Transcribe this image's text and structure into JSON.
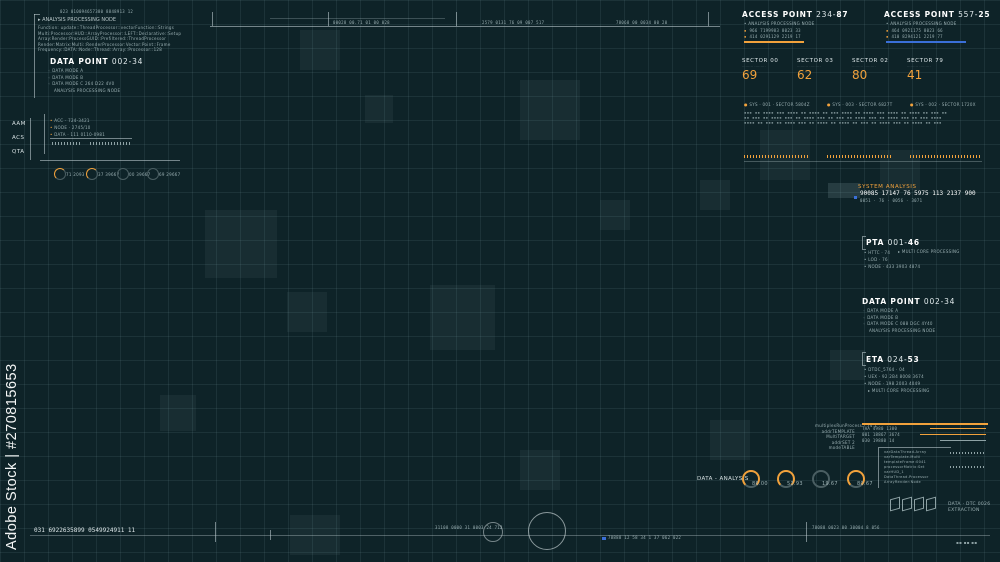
{
  "watermark": {
    "text": "Adobe Stock | #270815653"
  },
  "top_left_panel": {
    "code": "023  010094657380  8848913 12",
    "title": "ANALYSIS PROCESSING NODE",
    "lines": [
      "Function: update::ThreadProcessor::vectorFunction::Strings",
      "Multi:Processor:HUD::ArrayProcessor::LEFT::Declarative::Setup",
      "Array:Render:ProcessGUID::Prefiltered::ThreadProcessor",
      "Render:Matrix:Multi::RenderProcessor:Vector:Point::Frame",
      "Frequency::DATA::Node::Thread::Array::Processor::128"
    ]
  },
  "data_point_left": {
    "title": "DATA POINT",
    "value": "002-34",
    "items": [
      "DATA MODE A",
      "DATA MODE B",
      "DATA MODE C   264   D22   4V0"
    ],
    "footer": "ANALYSIS PROCESSING NODE"
  },
  "side_labels": [
    "AAM",
    "ACS",
    "QTA"
  ],
  "side_values": [
    "ACC · 724-3421",
    "NODE · 2745/10",
    "DATA · 111  0110-0981"
  ],
  "gauges_left": [
    "71 2093",
    "37 39667",
    "00 39667",
    "69 29667"
  ],
  "top_ruler": {
    "left_code": "00028  00.71  01  00  028",
    "mid_code": "2579  0131  76  09  007  517",
    "right_code": "78068  00  0034  00  20"
  },
  "access_points": [
    {
      "label": "ACCESS POINT",
      "num": "234-",
      "num2": "87",
      "sub": "ANALYSIS PROCESSING NODE",
      "rows": [
        "966  7199983  8023  33",
        "414  0291129  2219  17"
      ]
    },
    {
      "label": "ACCESS POINT",
      "num": "557-",
      "num2": "25",
      "sub": "ANALYSIS PROCESSING NODE",
      "rows": [
        "464  0921175  8023  66",
        "410  8294121  2219  77"
      ]
    }
  ],
  "sectors": [
    {
      "label": "SECTOR",
      "num": "00",
      "value": "69"
    },
    {
      "label": "SECTOR",
      "num": "03",
      "value": "62"
    },
    {
      "label": "SECTOR",
      "num": "02",
      "value": "80"
    },
    {
      "label": "SECTOR",
      "num": "79",
      "value": "41"
    }
  ],
  "sys_labels": [
    "SYS · 001 · SECTOR 5804Z",
    "SYS · 003 · SECTOR 6827T",
    "SYS · 002 · SECTOR 1720X"
  ],
  "system_analysis": {
    "title": "SYSTEM ANALYSIS",
    "numbers": "90085  17147   76  5975  113  2137   900",
    "sub": "0051 · 76 · 0056 · 3071"
  },
  "pta": {
    "title": "PTA",
    "value": "001-",
    "value2": "46",
    "items": [
      "HTTC · 74",
      "LOD · 76",
      "NODE · 433   3903   4874"
    ],
    "note": "MULTI CORE PROCESSING"
  },
  "data_point_right": {
    "title": "DATA POINT",
    "value": "002-34",
    "items": [
      "DATA MODE A",
      "DATA MODE B",
      "DATA MODE C   088   DGC   4Y40"
    ],
    "footer": "ANALYSIS PROCESSING NODE"
  },
  "eta": {
    "title": "ETA",
    "value": "024-",
    "value2": "53",
    "items": [
      "DTDC_5764 · 04",
      "UEX · 92   2B4   8008   3674",
      "NODE · 198   2003   4049"
    ],
    "note": "MULTI CORE PROCESSING"
  },
  "analysis_block": {
    "lines": [
      "multiplexRunProcess · 74.1",
      "addrTEMPLATE",
      "MultiTARGET",
      "addrSET 2",
      "modeTABLE"
    ],
    "rows": [
      "TAA   4980  1300",
      "001   18867  3674",
      "030   19880  14"
    ],
    "list": [
      "varDataThread.Array",
      "varTemplate.Multi",
      "templateFrame:0041",
      "processorMatrix:Set",
      "varHUD_1",
      "DataThread.Processor",
      "ArrayRender:Node"
    ]
  },
  "data_analysis": {
    "label": "DATA - ANALYSIS",
    "gauges": [
      "86.00",
      "53.93",
      "19.67",
      "80.67"
    ]
  },
  "extraction": {
    "line1": "DATA · DTC 0026",
    "line2": "EXTRACTION"
  },
  "bottom_ruler": {
    "left": "031    6922635899    0549924911    11",
    "mid": "31108  0000  31  0003  24  712",
    "mid2": "78888   12  58  34  1 37  062   022",
    "right": "78088   0023  00   30004  8  056"
  },
  "colors": {
    "background": "#0e2328",
    "accent": "#f2a23c",
    "grid": "#78a0a5",
    "text": "#c9d6d8"
  }
}
